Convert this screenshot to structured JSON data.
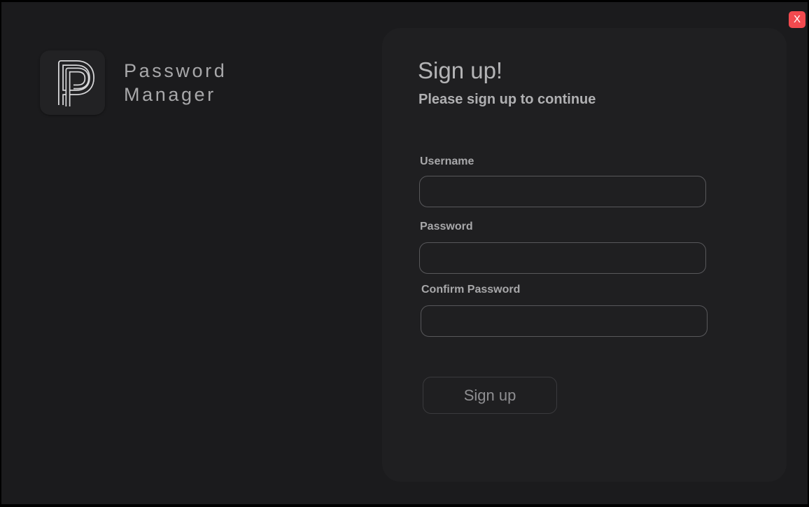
{
  "window": {
    "close_label": "X"
  },
  "brand": {
    "line1": "Password",
    "line2": "Manager",
    "logo_icon": "pp-monogram-icon"
  },
  "form": {
    "title": "Sign up!",
    "subtitle": "Please sign up to continue",
    "username_label": "Username",
    "username_value": "",
    "password_label": "Password",
    "password_value": "",
    "confirm_label": "Confirm Password",
    "confirm_value": "",
    "submit_label": "Sign up"
  },
  "colors": {
    "background": "#1b1b1d",
    "card": "#1f1f21",
    "close_button": "#f24a4f",
    "text": "#a8a8aa"
  }
}
